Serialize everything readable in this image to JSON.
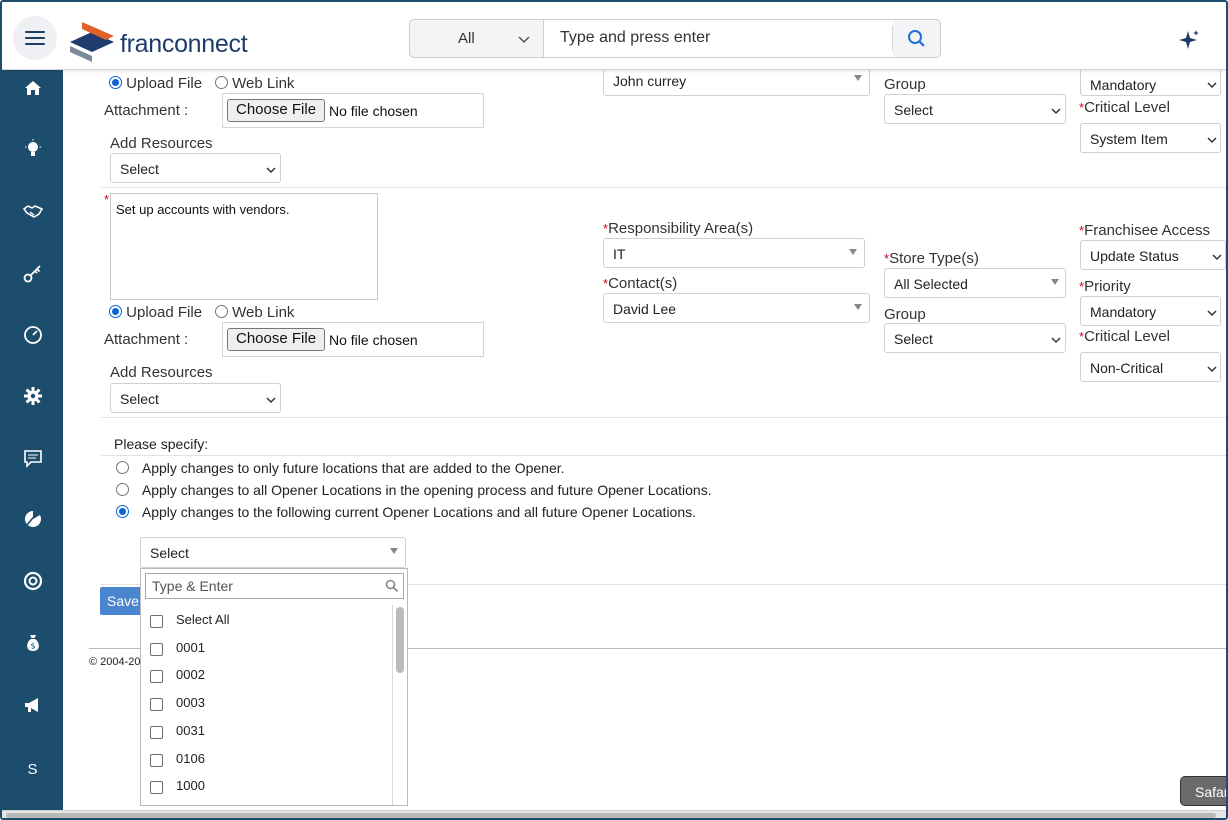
{
  "app": {
    "brand": "franconnect"
  },
  "search": {
    "scope": "All",
    "placeholder": "Type and press enter"
  },
  "sidebar": {
    "letter_item": "S"
  },
  "task1": {
    "upload_label": "Upload File",
    "weblink_label": "Web Link",
    "attachment_label": "Attachment :",
    "choose_file": "Choose File",
    "no_file": "No file chosen",
    "add_resources_label": "Add Resources",
    "add_resources_value": "Select",
    "contact_value": "John currey",
    "group_label": "Group",
    "group_value": "Select",
    "priority_value": "Mandatory",
    "critical_label": "Critical Level",
    "critical_value": "System Item"
  },
  "task2": {
    "description": "Set up accounts with vendors.",
    "upload_label": "Upload File",
    "weblink_label": "Web Link",
    "attachment_label": "Attachment :",
    "choose_file": "Choose File",
    "no_file": "No file chosen",
    "add_resources_label": "Add Resources",
    "add_resources_value": "Select",
    "responsibility_label": "Responsibility Area(s)",
    "responsibility_value": "IT",
    "contact_label": "Contact(s)",
    "contact_value": "David Lee",
    "store_type_label": "Store Type(s)",
    "store_type_value": "All Selected",
    "group_label": "Group",
    "group_value": "Select",
    "franchisee_access_label": "Franchisee Access",
    "franchisee_access_value": "Update Status",
    "priority_label": "Priority",
    "priority_value": "Mandatory",
    "critical_label": "Critical Level",
    "critical_value": "Non-Critical"
  },
  "apply": {
    "heading": "Please specify:",
    "options": [
      "Apply changes to only future locations that are added to the Opener.",
      "Apply changes to all Opener Locations in the opening process and future Opener Locations.",
      "Apply changes to the following current Opener Locations and all future Opener Locations."
    ],
    "selected_index": 2,
    "locations_select": "Select"
  },
  "locations_dropdown": {
    "search_placeholder": "Type & Enter",
    "items": [
      "Select All",
      "0001",
      "0002",
      "0003",
      "0031",
      "0106",
      "1000"
    ]
  },
  "footer": {
    "save_label": "Save",
    "copyright": "© 2004-20"
  },
  "tooltip": {
    "text": "Safari"
  }
}
